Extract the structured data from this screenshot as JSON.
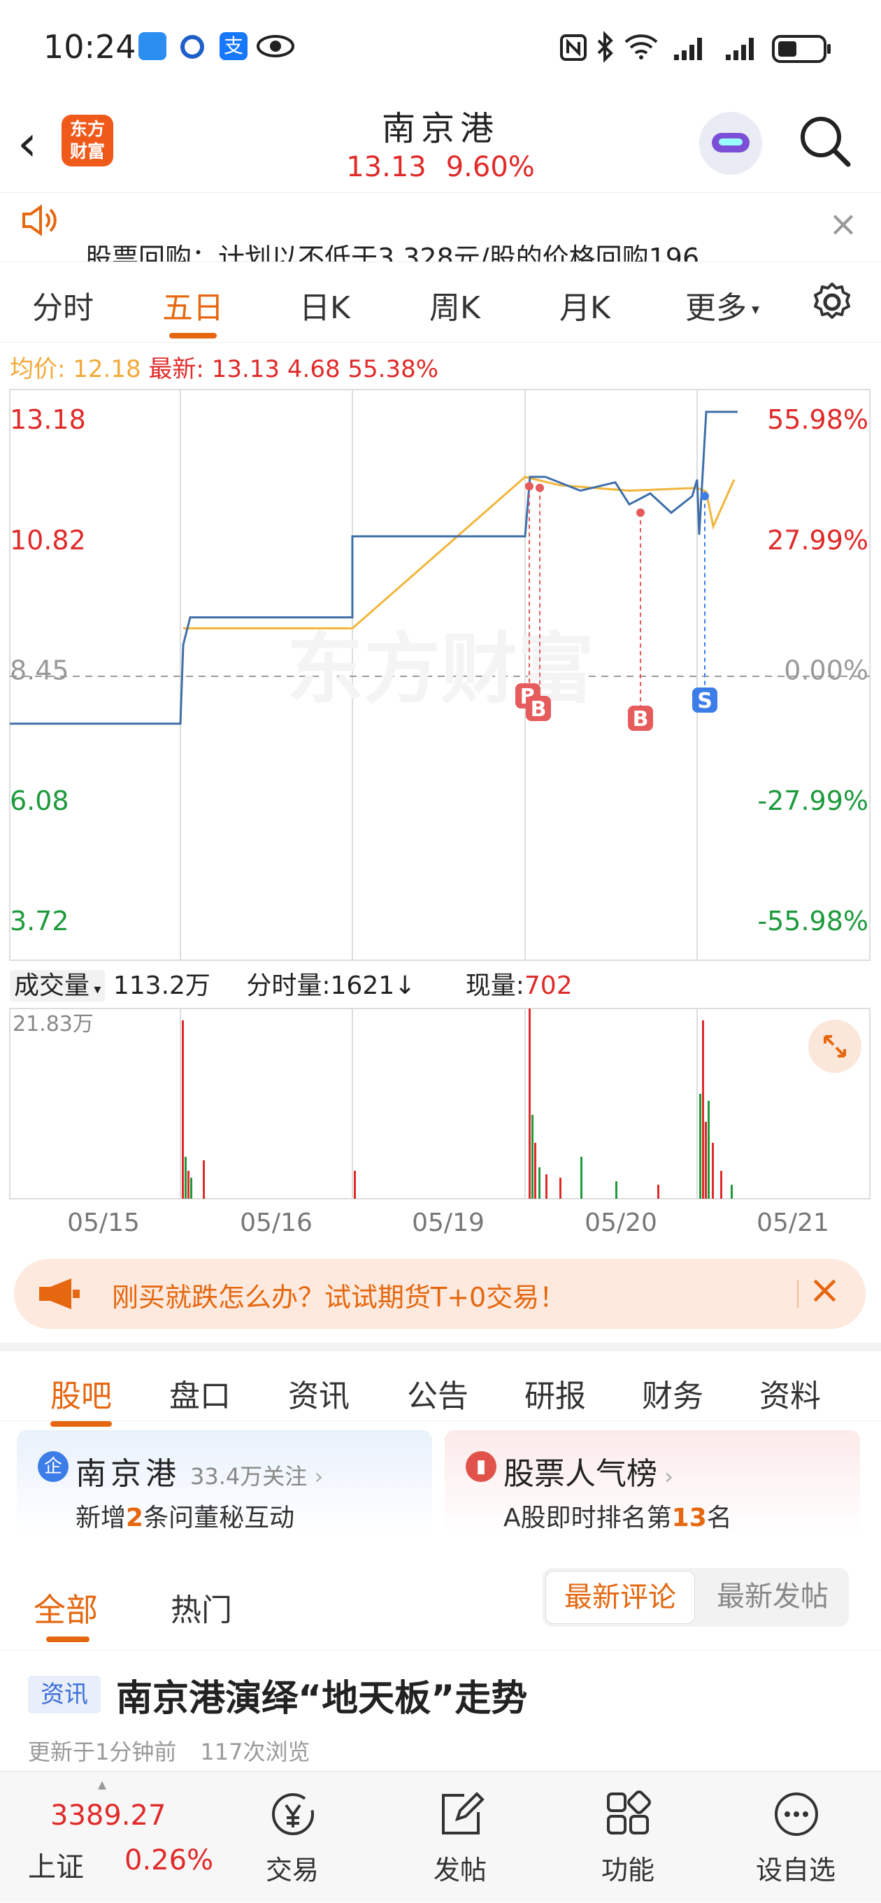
{
  "status_bar": {
    "time": "10:24"
  },
  "header": {
    "stock_name": "南京港",
    "price": "13.13",
    "change_pct": "9.60%",
    "logo_text_line1": "东方",
    "logo_text_line2": "财富"
  },
  "notice": {
    "text": "股票回购：计划以不低于3.328元/股的价格回购196...."
  },
  "tabs": [
    "分时",
    "五日",
    "日K",
    "周K",
    "月K",
    "更多"
  ],
  "tab_active": "五日",
  "price_info": {
    "avg_label": "均价:",
    "avg_value": "12.18",
    "latest_label": "最新:",
    "latest_value": "13.13",
    "change": "4.68",
    "change_pct": "55.38%"
  },
  "chart_data": {
    "type": "line",
    "y_ticks_left": [
      "13.18",
      "10.82",
      "8.45",
      "6.08",
      "3.72"
    ],
    "y_ticks_right": [
      "55.98%",
      "27.99%",
      "0.00%",
      "-27.99%",
      "-55.98%"
    ],
    "ylim": [
      3.72,
      13.18
    ],
    "base_price": 8.45,
    "x_days": [
      "05/15",
      "05/16",
      "05/19",
      "05/20",
      "05/21"
    ],
    "watermark": "东方财富",
    "trade_markers": [
      "B",
      "B",
      "B",
      "S"
    ],
    "series": [
      {
        "values": [
          7.47,
          7.47,
          7.47,
          8.9,
          9.4,
          9.4,
          9.4,
          10.87,
          10.87,
          10.87,
          11.95,
          11.95,
          11.7,
          11.85,
          11.45,
          11.65,
          11.3,
          11.6,
          11.9,
          10.9,
          13.13,
          13.13
        ]
      },
      {
        "values": [
          9.2,
          9.2,
          11.95,
          11.8,
          11.7,
          11.75,
          11.68,
          11.05,
          11.9
        ]
      }
    ],
    "colors": {
      "price": "#3f6fa8",
      "avg": "#f2b53a",
      "up": "#e02a2a",
      "down": "#1e9a3c"
    }
  },
  "volume": {
    "selector": "成交量",
    "total": "113.2万",
    "tick_label": "分时量:1621↓",
    "now_label": "现量:",
    "now_value": "702",
    "max_label": "21.83万"
  },
  "promo": {
    "text": "刚买就跌怎么办？试试期货T+0交易！"
  },
  "section_tabs": [
    "股吧",
    "盘口",
    "资讯",
    "公告",
    "研报",
    "财务",
    "资料"
  ],
  "card_left": {
    "name": "南京港",
    "follow": "33.4万关注",
    "sub_prefix": "新增",
    "sub_num": "2",
    "sub_suffix": "条问董秘互动",
    "icon": "企"
  },
  "card_right": {
    "name": "股票人气榜",
    "sub_prefix": "A股即时排名第",
    "sub_num": "13",
    "sub_suffix": "名"
  },
  "filter_tabs": {
    "all": "全部",
    "hot": "热门",
    "latest_comment": "最新评论",
    "latest_post": "最新发帖"
  },
  "news": {
    "tag": "资讯",
    "title": "南京港演绎“地天板”走势",
    "meta_time": "更新于1分钟前",
    "meta_views": "117次浏览"
  },
  "bottom_nav": {
    "index_value": "3389.27",
    "index_name": "上证",
    "index_change": "0.26%",
    "trade": "交易",
    "post": "发帖",
    "func": "功能",
    "watch": "设自选"
  }
}
